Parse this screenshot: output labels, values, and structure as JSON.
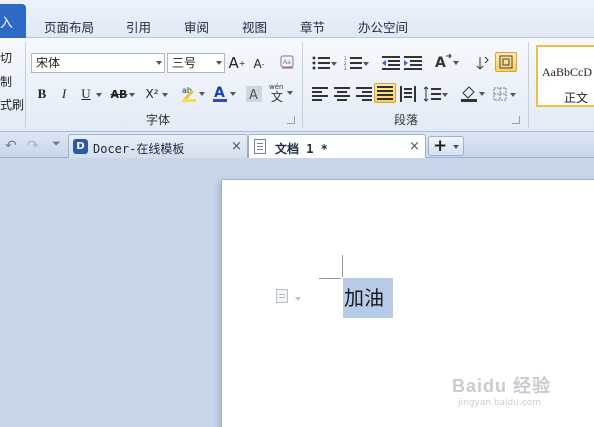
{
  "menubar": {
    "active_tab": "入",
    "items": [
      "页面布局",
      "引用",
      "审阅",
      "视图",
      "章节",
      "办公空间"
    ]
  },
  "ribbon": {
    "clipboard_fragments": [
      "切",
      "制",
      "式刷"
    ],
    "font_name": "宋体",
    "font_size": "三号",
    "font_group_label": "字体",
    "paragraph_group_label": "段落",
    "format_buttons": [
      "B",
      "I",
      "U",
      "AB",
      "X²"
    ],
    "styles": {
      "sample": "AaBbCcD",
      "name": "正文"
    }
  },
  "tabbar": {
    "tabs": [
      {
        "label": "Docer-在线模板",
        "close": "×"
      },
      {
        "label": "文档 1 *",
        "close": "×"
      }
    ],
    "new_tab": "+"
  },
  "document": {
    "text": "加油"
  },
  "watermark": {
    "brand": "Baidu 经验",
    "url": "jingyan.baidu.com"
  },
  "colors": {
    "accent": "#2f69c6",
    "selection": "#b7cbe9",
    "style_highlight": "#f0bd49"
  }
}
